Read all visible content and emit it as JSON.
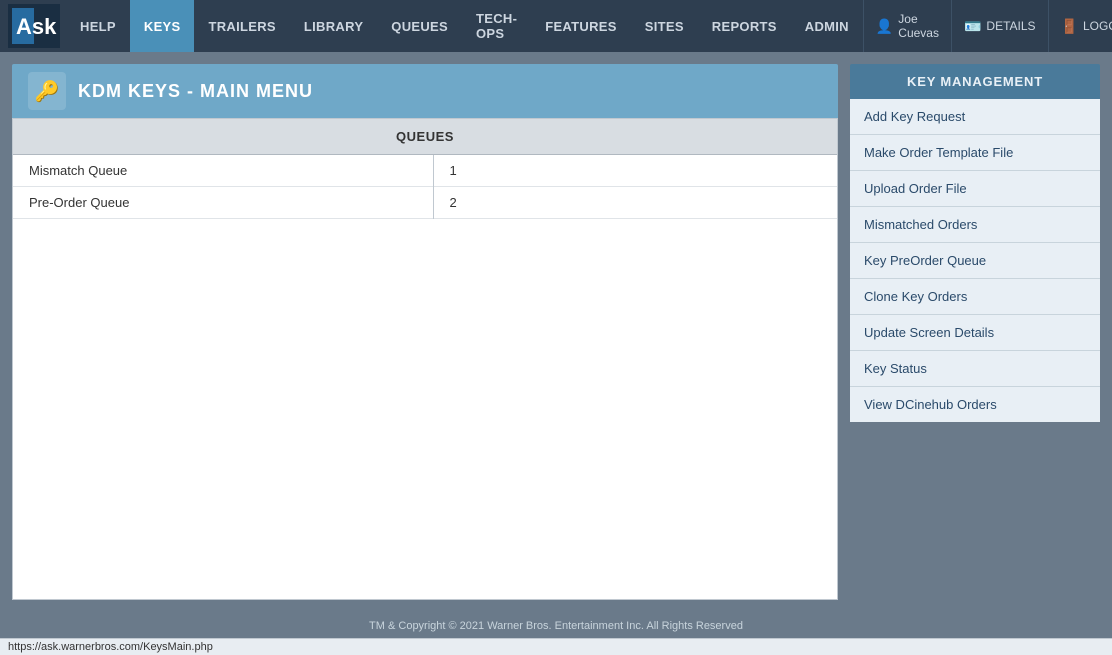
{
  "nav": {
    "logo_text": "Ask",
    "items": [
      {
        "label": "HELP",
        "active": false
      },
      {
        "label": "KEYS",
        "active": true
      },
      {
        "label": "TRAILERS",
        "active": false
      },
      {
        "label": "LIBRARY",
        "active": false
      },
      {
        "label": "QUEUES",
        "active": false
      },
      {
        "label": "TECH-OPS",
        "active": false
      },
      {
        "label": "FEATURES",
        "active": false
      },
      {
        "label": "SITES",
        "active": false
      },
      {
        "label": "REPORTS",
        "active": false
      },
      {
        "label": "ADMIN",
        "active": false
      }
    ],
    "user": "Joe Cuevas",
    "details_label": "DETAILS",
    "logout_label": "LOGOUT"
  },
  "page": {
    "title": "KDM KEYS - MAIN MENU",
    "header_icon": "🔑"
  },
  "queues": {
    "column_header": "QUEUES",
    "rows": [
      {
        "name": "Mismatch Queue",
        "count": "1"
      },
      {
        "name": "Pre-Order Queue",
        "count": "2"
      }
    ]
  },
  "sidebar": {
    "header": "KEY MANAGEMENT",
    "items": [
      {
        "label": "Add Key Request"
      },
      {
        "label": "Make Order Template File"
      },
      {
        "label": "Upload Order File"
      },
      {
        "label": "Mismatched Orders"
      },
      {
        "label": "Key PreOrder Queue"
      },
      {
        "label": "Clone Key Orders"
      },
      {
        "label": "Update Screen Details"
      },
      {
        "label": "Key Status"
      },
      {
        "label": "View DCinehub Orders"
      }
    ]
  },
  "footer": {
    "copyright": "TM & Copyright © 2021 Warner Bros. Entertainment Inc. All Rights Reserved"
  },
  "statusbar": {
    "url": "https://ask.warnerbros.com/KeysMain.php"
  }
}
